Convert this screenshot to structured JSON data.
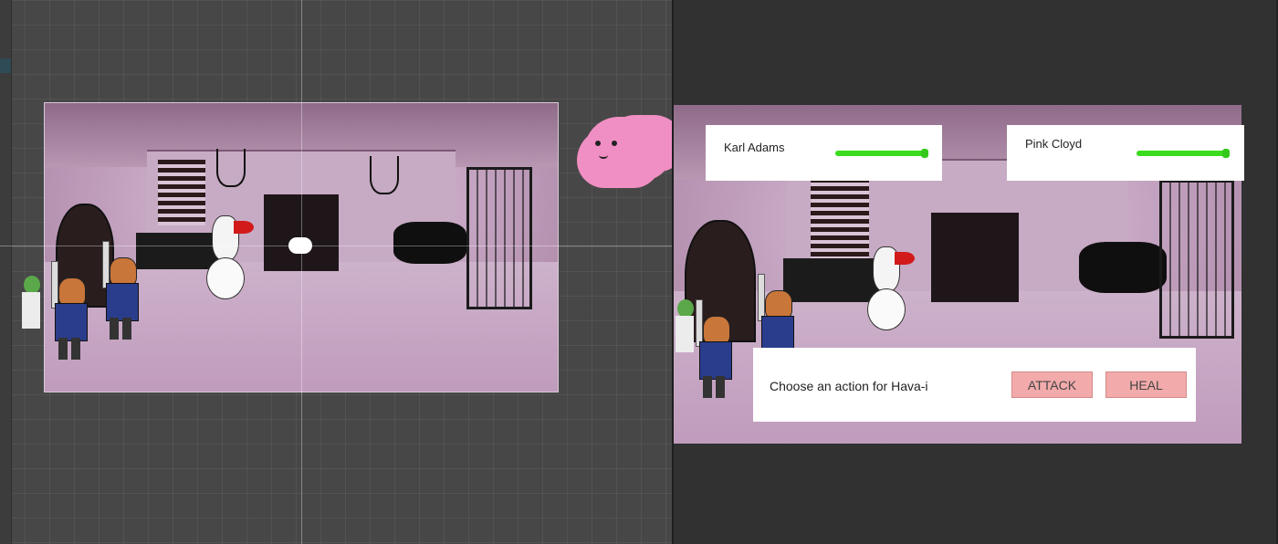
{
  "scene_view": {
    "grid_color": "#474747",
    "cloud_sprite": "pink-cloud-character-icon"
  },
  "game_view": {
    "party": [
      {
        "name": "Karl Adams",
        "hp_fraction": 0.97,
        "bar_color": "#3bdc1e"
      },
      {
        "name": "Pink Cloyd",
        "hp_fraction": 0.97,
        "bar_color": "#3bdc1e"
      }
    ],
    "action_panel": {
      "prompt": "Choose an action for Hava-i",
      "buttons": [
        {
          "label": "ATTACK",
          "color": "#f2aaaa"
        },
        {
          "label": "HEAL",
          "color": "#f2aaaa"
        }
      ]
    }
  }
}
